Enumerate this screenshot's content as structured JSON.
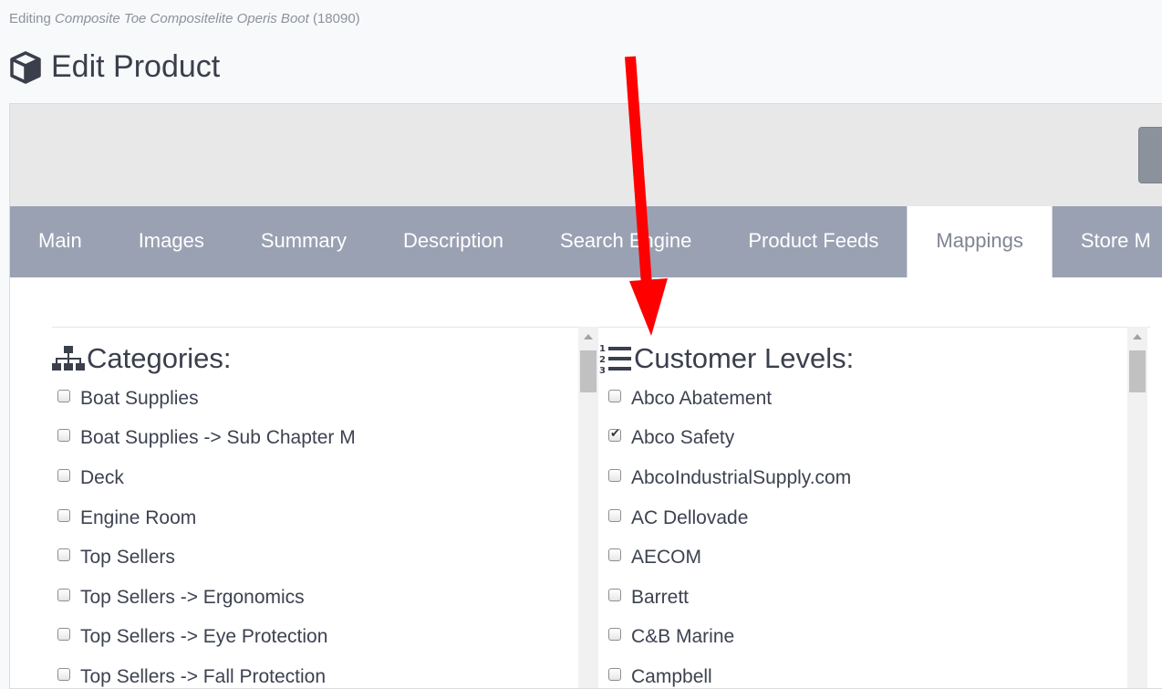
{
  "header": {
    "editing_prefix": "Editing",
    "product_name": "Composite Toe Compositelite Operis Boot",
    "product_id": "(18090)",
    "title": "Edit Product",
    "title_icon": "cube-icon"
  },
  "tabs": [
    {
      "label": "Main"
    },
    {
      "label": "Images"
    },
    {
      "label": "Summary"
    },
    {
      "label": "Description"
    },
    {
      "label": "Search Engine"
    },
    {
      "label": "Product Feeds"
    },
    {
      "label": "Mappings",
      "active": true
    },
    {
      "label": "Store M"
    }
  ],
  "categories": {
    "title": "Categories:",
    "icon": "sitemap-icon",
    "items": [
      {
        "label": "Boat Supplies",
        "checked": false
      },
      {
        "label": "Boat Supplies -> Sub Chapter M",
        "checked": false
      },
      {
        "label": "Deck",
        "checked": false
      },
      {
        "label": "Engine Room",
        "checked": false
      },
      {
        "label": "Top Sellers",
        "checked": false
      },
      {
        "label": "Top Sellers -> Ergonomics",
        "checked": false
      },
      {
        "label": "Top Sellers -> Eye Protection",
        "checked": false
      },
      {
        "label": "Top Sellers -> Fall Protection",
        "checked": false
      }
    ]
  },
  "customer_levels": {
    "title": "Customer Levels:",
    "icon": "ordered-list-icon",
    "items": [
      {
        "label": "Abco Abatement",
        "checked": false
      },
      {
        "label": "Abco Safety",
        "checked": true
      },
      {
        "label": "AbcoIndustrialSupply.com",
        "checked": false
      },
      {
        "label": "AC Dellovade",
        "checked": false
      },
      {
        "label": "AECOM",
        "checked": false
      },
      {
        "label": "Barrett",
        "checked": false
      },
      {
        "label": "C&B Marine",
        "checked": false
      },
      {
        "label": "Campbell",
        "checked": false
      }
    ]
  },
  "colors": {
    "tab_bar": "#9aa1b3",
    "annotation_arrow": "#ff0000"
  }
}
